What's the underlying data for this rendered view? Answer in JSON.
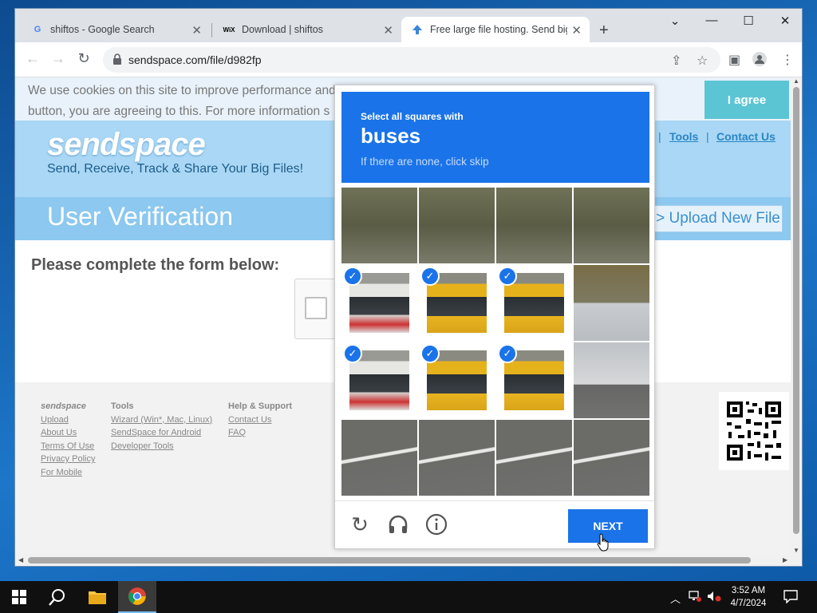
{
  "browser": {
    "tabs": [
      {
        "favicon": "G",
        "title": "shiftos - Google Search",
        "active": false
      },
      {
        "favicon": "WiX",
        "title": "Download | shiftos",
        "active": false
      },
      {
        "favicon": "arrow-up-icon",
        "title": "Free large file hosting. Send big",
        "active": true
      }
    ],
    "url": "sendspace.com/file/d982fp"
  },
  "page": {
    "cookie_text": "We use cookies on this site to improve performance and for analytics. By browsing this site, or clicking the 'I agree' button, you are agreeing to this. For more information s",
    "agree_label": "I agree",
    "logo": "sendspace",
    "tagline": "Send, Receive, Track & Share Your Big Files!",
    "nav": {
      "tools": "Tools",
      "contact": "Contact Us",
      "sep": "|"
    },
    "band_title": "User Verification",
    "upload_label": "> Upload New File",
    "form_heading": "Please complete the form below:",
    "footer": {
      "col1": {
        "heading": "sendspace",
        "links": [
          "Upload",
          "About Us",
          "Terms Of Use",
          "Privacy Policy",
          "For Mobile"
        ]
      },
      "col2": {
        "heading": "Tools",
        "links": [
          "Wizard (Win*, Mac, Linux)",
          "SendSpace for Android",
          "Developer Tools"
        ]
      },
      "col3": {
        "heading": "Help & Support",
        "links": [
          "Contact Us",
          "FAQ"
        ]
      }
    }
  },
  "captcha": {
    "instruction": "Select all squares with",
    "target": "buses",
    "hint": "If there are none, click skip",
    "selected": [
      false,
      false,
      false,
      false,
      true,
      true,
      true,
      false,
      true,
      true,
      true,
      false,
      false,
      false,
      false,
      false
    ],
    "next_label": "NEXT",
    "check_glyph": "✓"
  },
  "taskbar": {
    "time": "3:52 AM",
    "date": "4/7/2024"
  },
  "colors": {
    "captcha_blue": "#1a73e8",
    "agree_teal": "#5bc5d3"
  }
}
